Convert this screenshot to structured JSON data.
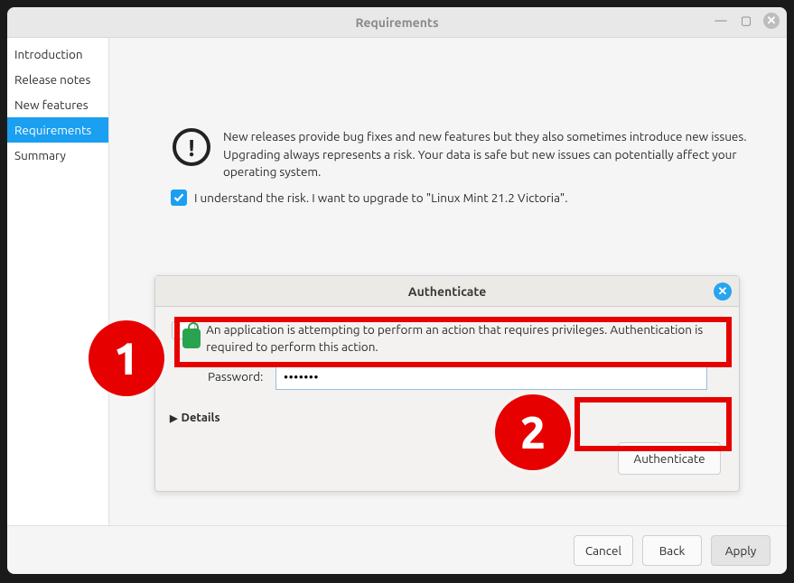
{
  "window": {
    "title": "Requirements"
  },
  "sidebar": {
    "items": [
      {
        "label": "Introduction"
      },
      {
        "label": "Release notes"
      },
      {
        "label": "New features"
      },
      {
        "label": "Requirements"
      },
      {
        "label": "Summary"
      }
    ]
  },
  "warn": {
    "text": "New releases provide bug fixes and new features but they also sometimes introduce new issues. Upgrading always represents a risk. Your data is safe but new issues can potentially affect your operating system."
  },
  "risk": {
    "label": "I understand the risk. I want to upgrade to \"Linux Mint 21.2 Victoria\"."
  },
  "auth": {
    "title": "Authenticate",
    "message": "An application is attempting to perform an action that requires privileges. Authentication is required to perform this action.",
    "password_label": "Password:",
    "password_value": "•••••••",
    "details_label": "Details",
    "button": "Authenticate"
  },
  "footer": {
    "cancel": "Cancel",
    "back": "Back",
    "apply": "Apply"
  },
  "callouts": {
    "one": "1",
    "two": "2"
  }
}
